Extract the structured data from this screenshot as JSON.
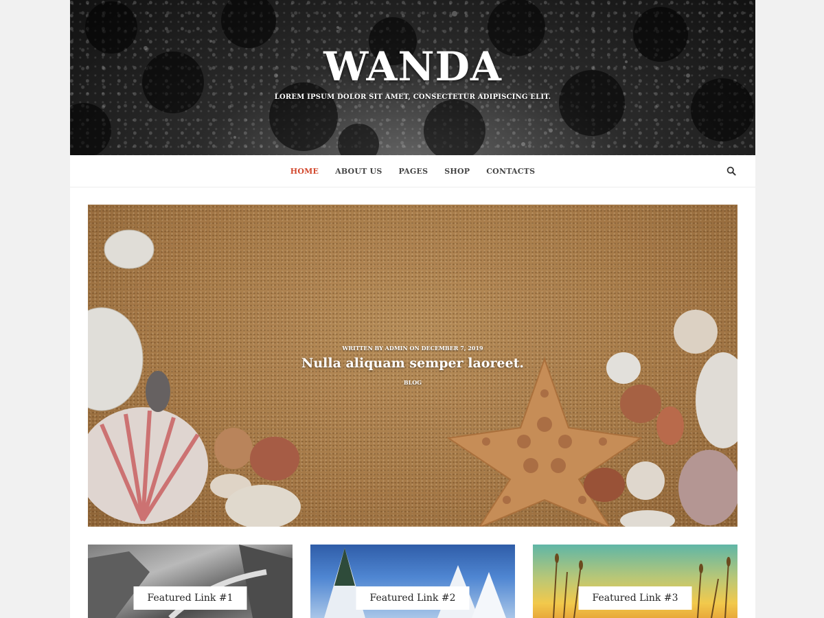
{
  "header": {
    "title": "WANDA",
    "tagline": "LOREM IPSUM DOLOR SIT AMET, CONSECTETUR ADIPISCING ELIT."
  },
  "nav": {
    "items": [
      {
        "label": "HOME",
        "active": true
      },
      {
        "label": "ABOUT US",
        "active": false
      },
      {
        "label": "PAGES",
        "active": false
      },
      {
        "label": "SHOP",
        "active": false
      },
      {
        "label": "CONTACTS",
        "active": false
      }
    ],
    "search_icon": "search-icon",
    "active_color": "#d2472c"
  },
  "hero": {
    "meta": "WRITTEN BY ADMIN ON DECEMBER 7, 2019",
    "title": "Nulla aliquam semper laoreet.",
    "category": "BLOG"
  },
  "featured": [
    {
      "label": "Featured Link #1"
    },
    {
      "label": "Featured Link #2"
    },
    {
      "label": "Featured Link #3"
    }
  ]
}
